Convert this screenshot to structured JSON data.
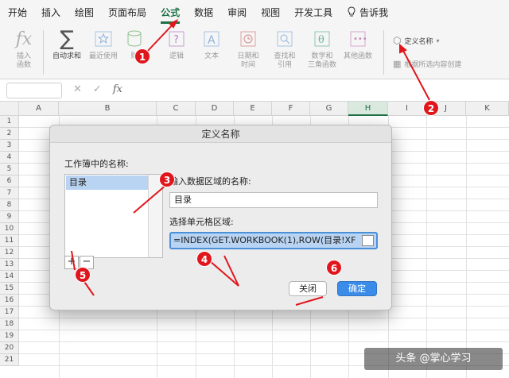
{
  "ribbon_tabs": [
    {
      "label": "开始"
    },
    {
      "label": "插入"
    },
    {
      "label": "绘图"
    },
    {
      "label": "页面布局"
    },
    {
      "label": "公式",
      "active": true
    },
    {
      "label": "数据"
    },
    {
      "label": "审阅"
    },
    {
      "label": "视图"
    },
    {
      "label": "开发工具"
    }
  ],
  "tell_me": "告诉我",
  "ribbon_buttons": {
    "insert_function": "插入\n函数",
    "autosum": "自动求和",
    "recent": "最近使用",
    "financial": "财",
    "logical": "逻辑",
    "text": "文本",
    "datetime": "日期和\n时间",
    "lookup": "查找和\n引用",
    "math": "数学和\n三角函数",
    "more": "其他函数",
    "define_name": "定义名称",
    "create_from_selection": "根据所选内容创建"
  },
  "formula_bar": {
    "fx": "fx"
  },
  "columns": [
    "A",
    "B",
    "C",
    "D",
    "E",
    "F",
    "G",
    "H",
    "I",
    "J",
    "K"
  ],
  "selected_column": "H",
  "rows": [
    "1",
    "2",
    "3",
    "4",
    "5",
    "6",
    "7",
    "8",
    "9",
    "10",
    "11",
    "12",
    "13",
    "14",
    "15",
    "16",
    "17",
    "18",
    "19",
    "20",
    "21"
  ],
  "dialog": {
    "title": "定义名称",
    "workbook_names_label": "工作簿中的名称:",
    "names": [
      "目录"
    ],
    "name_prompt": "输入数据区域的名称:",
    "name_value": "目录",
    "range_prompt": "选择单元格区域:",
    "range_value": "=INDEX(GET.WORKBOOK(1),ROW(目录!XF",
    "add_button": "+",
    "remove_button": "−",
    "cancel_button": "关闭",
    "ok_button": "确定"
  },
  "markers": [
    "1",
    "2",
    "3",
    "4",
    "5",
    "6"
  ],
  "watermark": "头条 @掌心学习",
  "colors": {
    "accent": "#1e7145",
    "marker": "#e0161c",
    "ok_button": "#3b8ce8",
    "selection": "#b9d4f3"
  }
}
